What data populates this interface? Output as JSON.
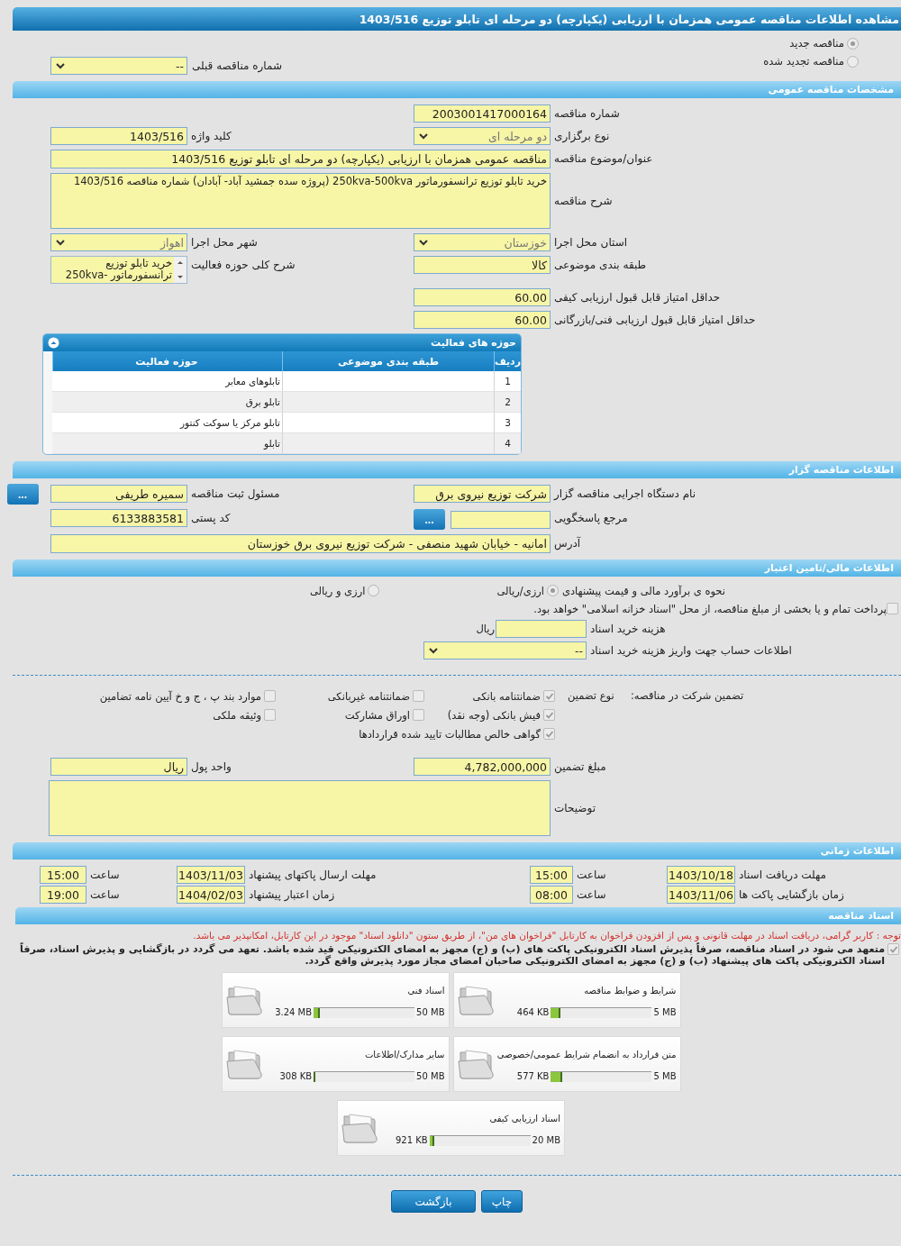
{
  "title": "مشاهده اطلاعات مناقصه عمومی همزمان با ارزیابی (یکپارچه) دو مرحله ای تابلو توزیع 1403/516",
  "tender_status": [
    {
      "label": "مناقصه جدید",
      "selected": true
    },
    {
      "label": "مناقصه تجدید شده",
      "selected": false
    }
  ],
  "previous_tender": {
    "label": "شماره مناقصه قبلی",
    "value": "--"
  },
  "general": {
    "heading": "مشخصات مناقصه عمومی",
    "rows": [
      [
        {
          "kind": "input",
          "label": "شماره مناقصه",
          "value": "2003001417000164"
        }
      ],
      [
        {
          "kind": "select",
          "label": "نوع برگزاری",
          "value": "دو مرحله ای"
        },
        {
          "kind": "input",
          "label": "کلید واژه",
          "value": "1403/516"
        }
      ],
      [
        {
          "kind": "wide",
          "label": "عنوان/موضوع مناقصه",
          "value": "مناقصه عمومی همزمان با ارزیابی (یکپارچه) دو مرحله ای تابلو توزیع 1403/516"
        }
      ],
      [
        {
          "kind": "widearea",
          "label": "شرح مناقصه",
          "value": "خرید تابلو توزیع ترانسفورماتور 250kva-500kva (پروژه سده جمشید آباد- آبادان) شماره مناقصه 1403/516"
        }
      ],
      [
        {
          "kind": "select",
          "label": "استان محل اجرا",
          "value": "خوزستان"
        },
        {
          "kind": "select",
          "label": "شهر محل اجرا",
          "value": "اهواز"
        }
      ],
      [
        {
          "kind": "input",
          "label": "طبقه بندی موضوعی",
          "value": "کالا"
        },
        {
          "kind": "list",
          "label": "شرح کلی حوزه فعالیت",
          "value": "خرید تابلو توزیع ترانسفورماتور -250kva"
        }
      ],
      [
        {
          "kind": "input",
          "label": "حداقل امتیاز قابل قبول ارزیابی کیفی",
          "value": "60.00"
        }
      ],
      [
        {
          "kind": "input",
          "label": "حداقل امتیاز قابل قبول ارزیابی فنی/بازرگانی",
          "value": "60.00"
        }
      ]
    ]
  },
  "activities": {
    "heading": "حوزه های فعالیت",
    "columns": [
      "ردیف",
      "طبقه بندی موضوعی",
      "حوزه فعالیت"
    ],
    "rows": [
      {
        "index": "1",
        "activity": "تابلوهای معابر"
      },
      {
        "index": "2",
        "activity": "تابلو برق"
      },
      {
        "index": "3",
        "activity": "تابلو مرکز یا سوکت کنتور"
      },
      {
        "index": "4",
        "activity": "تابلو"
      }
    ]
  },
  "organizer": {
    "heading": "اطلاعات مناقصه گزار",
    "rows": [
      [
        {
          "kind": "input",
          "label": "نام دستگاه اجرایی مناقصه گزار",
          "value": "شرکت توزیع نیروی برق"
        },
        {
          "kind": "input",
          "label": "مسئول ثبت مناقصه",
          "value": "سمیره طریفی",
          "button": "..."
        }
      ],
      [
        {
          "kind": "input",
          "label": "مرجع پاسخگویی",
          "button": "..."
        },
        {
          "kind": "input",
          "label": "کد پستی",
          "value": "6133883581"
        }
      ],
      [
        {
          "kind": "wide",
          "label": "آدرس",
          "value": "امانیه - خیابان شهید منصفی - شرکت توزیع نیروی برق خوزستان"
        }
      ]
    ]
  },
  "finance": {
    "heading": "اطلاعات مالی/تامین اعتبار",
    "estimate": {
      "label": "نحوه ی برآورد مالی و قیمت پیشنهادی",
      "options": [
        {
          "label": "ارزی/ریالی",
          "selected": true
        },
        {
          "label": "ارزی و ریالی",
          "selected": false
        }
      ]
    },
    "treasury": {
      "label": "پرداخت تمام و یا بخشی از مبلغ مناقصه، از محل \"اسناد خزانه اسلامی\" خواهد بود.",
      "checked": false
    },
    "document_cost": {
      "label": "هزینه خرید اسناد",
      "unit": "ریال"
    },
    "account": {
      "label": "اطلاعات حساب جهت واریز هزینه خرید اسناد",
      "value": "--"
    },
    "guarantee": {
      "label": "تضمین شرکت در مناقصه:",
      "type_label": "نوع تضمین",
      "options": [
        {
          "label": "ضمانتنامه بانکی",
          "checked": true
        },
        {
          "label": "ضمانتنامه غیربانکی",
          "checked": false
        },
        {
          "label": "موارد بند پ ، ج و خ آیین نامه تضامین",
          "checked": false
        },
        {
          "label": "فیش بانکی (وجه نقد)",
          "checked": true
        },
        {
          "label": "اوراق مشارکت",
          "checked": false
        },
        {
          "label": "وثیقه ملکی",
          "checked": false
        },
        {
          "label": "گواهی خالص مطالبات تایید شده قراردادها",
          "checked": true
        }
      ]
    },
    "rows": [
      [
        {
          "kind": "input",
          "label": "مبلغ تضمین",
          "value": "4,782,000,000"
        },
        {
          "kind": "input",
          "label": "واحد پول",
          "value": "ریال"
        }
      ],
      [
        {
          "kind": "widearea",
          "label": "توضیحات"
        }
      ]
    ]
  },
  "timing": {
    "heading": "اطلاعات زمانی",
    "rows": [
      [
        {
          "label": "مهلت دریافت اسناد",
          "date": "1403/10/18",
          "time_label": "ساعت",
          "time": "15:00"
        },
        {
          "label": "مهلت ارسال پاکتهای پیشنهاد",
          "date": "1403/11/03",
          "time_label": "ساعت",
          "time": "15:00"
        }
      ],
      [
        {
          "label": "زمان بازگشایی پاکت ها",
          "date": "1403/11/06",
          "time_label": "ساعت",
          "time": "08:00"
        },
        {
          "label": "زمان اعتبار پیشنهاد",
          "date": "1404/02/03",
          "time_label": "ساعت",
          "time": "19:00"
        }
      ]
    ]
  },
  "documents": {
    "heading": "اسناد مناقصه",
    "notice": "توجه : کاربر گرامی، دریافت اسناد در مهلت قانونی و پس از افزودن فراخوان به کارتابل \"فراخوان های من\"، از طریق ستون \"دانلود اسناد\" موجود در این کارتابل، امکانپذیر می باشد.",
    "commitment": {
      "text": "متعهد می شود در اسناد مناقصه، صرفاً پذیرش اسناد الکترونیکی پاکت های (ب) و (ج) مجهز به امضای الکترونیکی قید شده باشد. تعهد می گردد در بازگشایی و پذیرش اسناد، صرفاً اسناد الکترونیکی پاکت های پیشنهاد (ب) و (ج) مجهز به امضای الکترونیکی صاحبان امضای مجاز مورد پذیرش واقع گردد.",
      "checked": true
    },
    "files": [
      {
        "title": "شرایط و ضوابط مناقصه",
        "size": "464 KB",
        "max": "5 MB",
        "level": 0.09
      },
      {
        "title": "اسناد فنی",
        "size": "3.24 MB",
        "max": "50 MB",
        "level": 0.065
      },
      {
        "title": "متن قرارداد به انضمام شرایط عمومی/خصوصی",
        "size": "577 KB",
        "max": "5 MB",
        "level": 0.11
      },
      {
        "title": "سایر مدارک/اطلاعات",
        "size": "308 KB",
        "max": "50 MB",
        "level": 0.006
      },
      {
        "title": "اسناد ارزیابی کیفی",
        "size": "921 KB",
        "max": "20 MB",
        "level": 0.045
      }
    ]
  },
  "buttons": [
    {
      "label": "چاپ"
    },
    {
      "label": "بازگشت"
    }
  ]
}
